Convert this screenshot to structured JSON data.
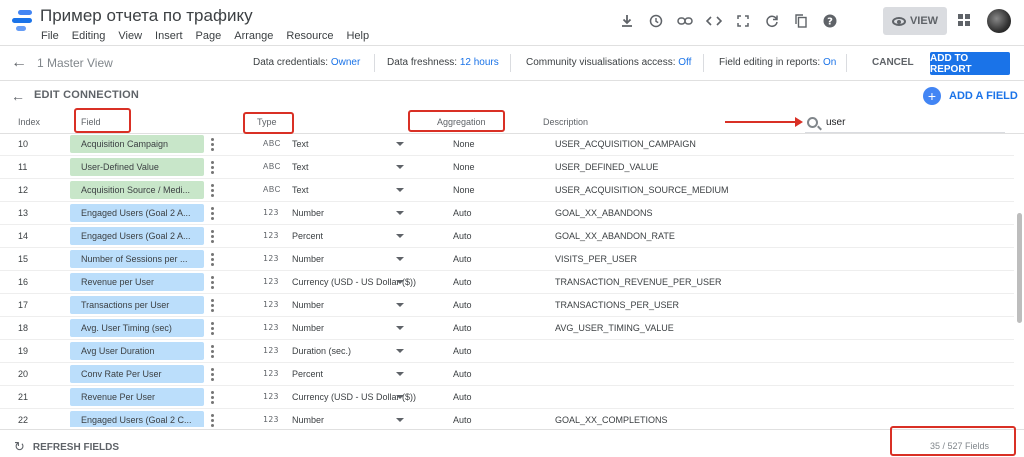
{
  "app": {
    "title": "Пример отчета по трафику",
    "menu": [
      "File",
      "Editing",
      "View",
      "Insert",
      "Page",
      "Arrange",
      "Resource",
      "Help"
    ],
    "view_label": "VIEW",
    "icons": [
      "download-icon",
      "history-icon",
      "link-icon",
      "embed-code-icon",
      "fullscreen-icon",
      "refresh-icon",
      "copy-icon",
      "help-icon"
    ]
  },
  "toolbar": {
    "master_view": "1 Master View",
    "credentials_label": "Data credentials:",
    "credentials_value": "Owner",
    "freshness_label": "Data freshness:",
    "freshness_value": "12 hours",
    "community_label": "Community visualisations access:",
    "community_value": "Off",
    "field_editing_label": "Field editing in reports:",
    "field_editing_value": "On",
    "cancel_label": "CANCEL",
    "add_report_label": "ADD TO REPORT"
  },
  "edit": {
    "label": "EDIT CONNECTION",
    "add_field_label": "ADD A FIELD"
  },
  "columns": {
    "index": "Index",
    "field": "Field",
    "type": "Type",
    "aggregation": "Aggregation",
    "description": "Description"
  },
  "search": {
    "value": "user"
  },
  "rows": [
    {
      "index": "10",
      "field": "Acquisition Campaign",
      "kind": "dim",
      "type_icon": "ABC",
      "type": "Text",
      "agg": "None",
      "desc": "USER_ACQUISITION_CAMPAIGN"
    },
    {
      "index": "11",
      "field": "User-Defined Value",
      "kind": "dim",
      "type_icon": "ABC",
      "type": "Text",
      "agg": "None",
      "desc": "USER_DEFINED_VALUE"
    },
    {
      "index": "12",
      "field": "Acquisition Source / Medi...",
      "kind": "dim",
      "type_icon": "ABC",
      "type": "Text",
      "agg": "None",
      "desc": "USER_ACQUISITION_SOURCE_MEDIUM"
    },
    {
      "index": "13",
      "field": "Engaged Users (Goal 2 A...",
      "kind": "met",
      "type_icon": "123",
      "type": "Number",
      "agg": "Auto",
      "desc": "GOAL_XX_ABANDONS"
    },
    {
      "index": "14",
      "field": "Engaged Users (Goal 2 A...",
      "kind": "met",
      "type_icon": "123",
      "type": "Percent",
      "agg": "Auto",
      "desc": "GOAL_XX_ABANDON_RATE"
    },
    {
      "index": "15",
      "field": "Number of Sessions per ...",
      "kind": "met",
      "type_icon": "123",
      "type": "Number",
      "agg": "Auto",
      "desc": "VISITS_PER_USER"
    },
    {
      "index": "16",
      "field": "Revenue per User",
      "kind": "met",
      "type_icon": "123",
      "type": "Currency (USD - US Dollar ($))",
      "agg": "Auto",
      "desc": "TRANSACTION_REVENUE_PER_USER"
    },
    {
      "index": "17",
      "field": "Transactions per User",
      "kind": "met",
      "type_icon": "123",
      "type": "Number",
      "agg": "Auto",
      "desc": "TRANSACTIONS_PER_USER"
    },
    {
      "index": "18",
      "field": "Avg. User Timing (sec)",
      "kind": "met",
      "type_icon": "123",
      "type": "Number",
      "agg": "Auto",
      "desc": "AVG_USER_TIMING_VALUE"
    },
    {
      "index": "19",
      "field": "Avg User Duration",
      "kind": "met",
      "type_icon": "123",
      "type": "Duration (sec.)",
      "agg": "Auto",
      "desc": ""
    },
    {
      "index": "20",
      "field": "Conv Rate Per User",
      "kind": "met",
      "type_icon": "123",
      "type": "Percent",
      "agg": "Auto",
      "desc": ""
    },
    {
      "index": "21",
      "field": "Revenue Per User",
      "kind": "met",
      "type_icon": "123",
      "type": "Currency (USD - US Dollar ($))",
      "agg": "Auto",
      "desc": ""
    },
    {
      "index": "22",
      "field": "Engaged Users (Goal 2 C...",
      "kind": "met",
      "type_icon": "123",
      "type": "Number",
      "agg": "Auto",
      "desc": "GOAL_XX_COMPLETIONS"
    }
  ],
  "footer": {
    "refresh_label": "REFRESH FIELDS",
    "field_count": "35 / 527 Fields"
  },
  "colors": {
    "accent": "#1a73e8",
    "dimension_chip": "#c8e6c9",
    "metric_chip": "#bbdefb",
    "highlight_red": "#d93025"
  }
}
